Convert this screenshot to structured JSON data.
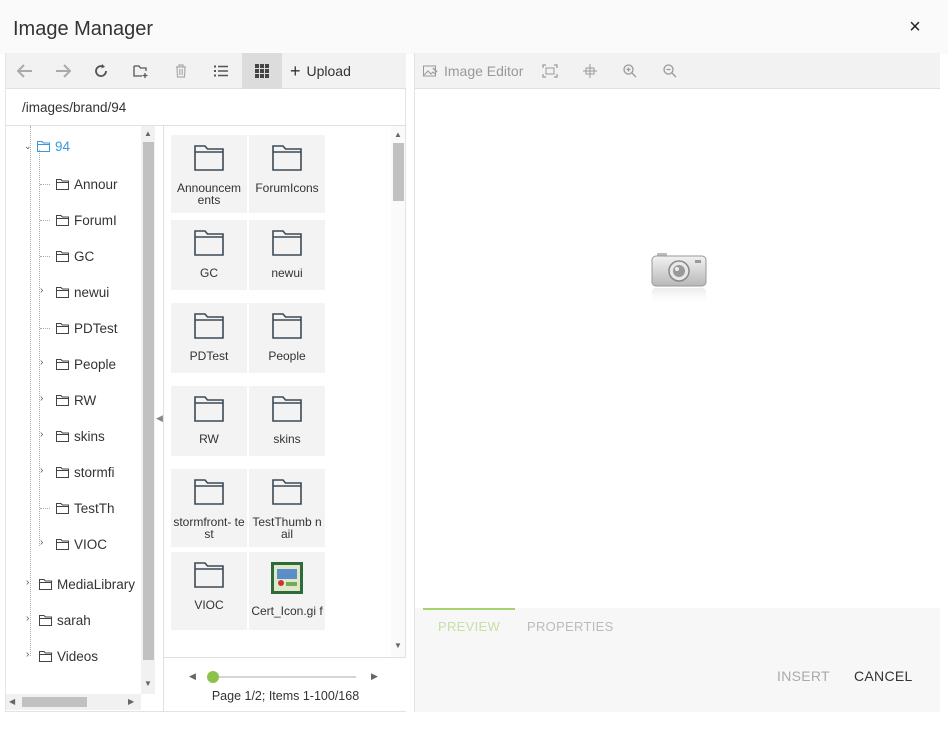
{
  "window": {
    "title": "Image Manager",
    "close_label": "×"
  },
  "toolbar": {
    "buttons": [
      {
        "name": "back-button",
        "icon": "back-arrow-icon",
        "disabled": true
      },
      {
        "name": "forward-button",
        "icon": "forward-arrow-icon",
        "disabled": true
      },
      {
        "name": "refresh-button",
        "icon": "refresh-icon",
        "disabled": false
      },
      {
        "name": "new-folder-button",
        "icon": "new-folder-icon",
        "disabled": false
      },
      {
        "name": "delete-button",
        "icon": "trash-icon",
        "disabled": true
      },
      {
        "name": "list-view-button",
        "icon": "list-view-icon",
        "disabled": false
      },
      {
        "name": "grid-view-button",
        "icon": "grid-view-icon",
        "disabled": false,
        "active": true
      }
    ],
    "upload_label": "Upload"
  },
  "path": "/images/brand/94",
  "tree": {
    "root": {
      "label": "94",
      "expanded": true,
      "selected": true
    },
    "children": [
      {
        "label": "Annour",
        "expandable": false
      },
      {
        "label": "ForumI",
        "expandable": false
      },
      {
        "label": "GC",
        "expandable": false
      },
      {
        "label": "newui",
        "expandable": true
      },
      {
        "label": "PDTest",
        "expandable": false
      },
      {
        "label": "People",
        "expandable": true
      },
      {
        "label": "RW",
        "expandable": true
      },
      {
        "label": "skins",
        "expandable": true
      },
      {
        "label": "stormfi",
        "expandable": true
      },
      {
        "label": "TestTh",
        "expandable": false
      },
      {
        "label": "VIOC",
        "expandable": true
      }
    ],
    "siblings": [
      {
        "label": "MediaLibrary"
      },
      {
        "label": "sarah"
      },
      {
        "label": "Videos"
      }
    ]
  },
  "grid": {
    "items": [
      {
        "label": "Announcem ents",
        "type": "folder"
      },
      {
        "label": "ForumIcons",
        "type": "folder"
      },
      {
        "label": "GC",
        "type": "folder"
      },
      {
        "label": "newui",
        "type": "folder"
      },
      {
        "label": "PDTest",
        "type": "folder"
      },
      {
        "label": "People",
        "type": "folder"
      },
      {
        "label": "RW",
        "type": "folder"
      },
      {
        "label": "skins",
        "type": "folder"
      },
      {
        "label": "stormfront- test",
        "type": "folder"
      },
      {
        "label": "TestThumb nail",
        "type": "folder"
      },
      {
        "label": "VIOC",
        "type": "folder"
      },
      {
        "label": "Cert_Icon.gi f",
        "type": "image"
      }
    ]
  },
  "pager": {
    "text": "Page 1/2; Items 1-100/168",
    "position_fraction": 0.0
  },
  "right_toolbar": {
    "editor_label": "Image Editor",
    "buttons": [
      {
        "name": "fit-button",
        "icon": "fit-to-frame-icon"
      },
      {
        "name": "actual-size-button",
        "icon": "actual-size-icon"
      },
      {
        "name": "zoom-in-button",
        "icon": "zoom-in-icon"
      },
      {
        "name": "zoom-out-button",
        "icon": "zoom-out-icon"
      }
    ]
  },
  "preview": {
    "placeholder_icon": "camera-icon"
  },
  "tabs": [
    {
      "label": "PREVIEW",
      "active": true
    },
    {
      "label": "PROPERTIES",
      "active": false
    }
  ],
  "actions": {
    "insert_label": "INSERT",
    "cancel_label": "CANCEL"
  },
  "colors": {
    "accent": "#8bc34a",
    "selected_tree": "#3a9bd8",
    "toolbar_bg": "#f2f2f2"
  }
}
